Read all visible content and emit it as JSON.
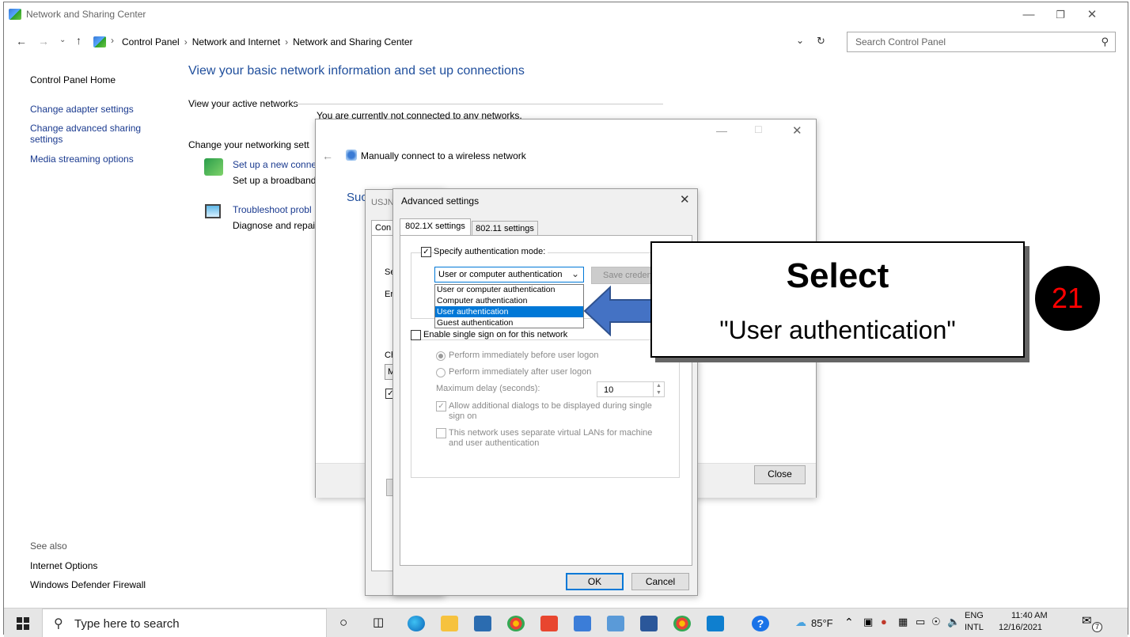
{
  "window": {
    "title": "Network and Sharing Center"
  },
  "address": {
    "crumbs": [
      "Control Panel",
      "Network and Internet",
      "Network and Sharing Center"
    ],
    "search_placeholder": "Search Control Panel"
  },
  "sidebar": {
    "items": [
      {
        "label": "Control Panel Home"
      },
      {
        "label": "Change adapter settings"
      },
      {
        "label": "Change advanced sharing settings"
      },
      {
        "label": "Media streaming options"
      }
    ],
    "see_also": "See also",
    "see_also_items": [
      {
        "label": "Internet Options"
      },
      {
        "label": "Windows Defender Firewall"
      }
    ]
  },
  "main": {
    "heading": "View your basic network information and set up connections",
    "active_networks_label": "View your active networks",
    "not_connected": "You are currently not connected to any networks.",
    "change_settings_label": "Change your networking sett",
    "setup_link": "Set up a new conne",
    "setup_desc": "Set up a broadband",
    "troubleshoot_link": "Troubleshoot probl",
    "troubleshoot_desc": "Diagnose and repai"
  },
  "wizard": {
    "title": "Manually connect to a wireless network",
    "partial_heading": "Suc",
    "close_label": "Close"
  },
  "props_dialog": {
    "title_partial": "USJN",
    "tab_partial": "Con",
    "label_se": "Se",
    "label_en": "Er",
    "label_ch": "Ch",
    "label_m": "M"
  },
  "advanced": {
    "title": "Advanced settings",
    "tabs": [
      "802.1X settings",
      "802.11 settings"
    ],
    "specify_auth_label": "Specify authentication mode:",
    "auth_selected": "User or computer authentication",
    "auth_options": [
      "User or computer authentication",
      "Computer authentication",
      "User authentication",
      "Guest authentication"
    ],
    "highlighted_option_index": 2,
    "save_credentials_partial": "Save creden",
    "sso_label": "Enable single sign on for this network",
    "perform_before": "Perform immediately before user logon",
    "perform_after": "Perform immediately after user logon",
    "max_delay_label": "Maximum delay (seconds):",
    "max_delay_value": "10",
    "allow_dialogs": "Allow additional dialogs to be displayed during single sign on",
    "vlan_label": "This network uses separate virtual LANs for machine and user authentication",
    "ok_label": "OK",
    "cancel_label": "Cancel"
  },
  "callout": {
    "title": "Select",
    "subtitle": "\"User authentication\"",
    "step_number": "21"
  },
  "taskbar": {
    "search_placeholder": "Type here to search",
    "weather": "85°F",
    "language_top": "ENG",
    "language_bottom": "INTL",
    "time": "11:40 AM",
    "date": "12/16/2021",
    "notification_count": "7"
  },
  "colors": {
    "link": "#1a3a8f",
    "heading": "#1f4e9c",
    "selection": "#0078d7",
    "arrow": "#4472c4",
    "step_badge_bg": "#000000",
    "step_badge_text": "#ff0000"
  }
}
